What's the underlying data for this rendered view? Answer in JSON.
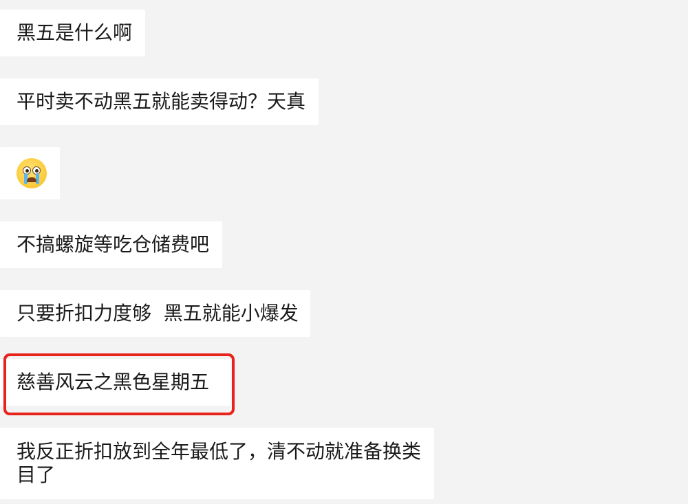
{
  "messages": [
    {
      "text": "黑五是什么啊"
    },
    {
      "text": "平时卖不动黑五就能卖得动？天真"
    },
    {
      "emoji": "crying-face-icon"
    },
    {
      "text": "不搞螺旋等吃仓储费吧"
    },
    {
      "text": "只要折扣力度够  黑五就能小爆发"
    },
    {
      "text": "慈善风云之黑色星期五",
      "highlighted": true
    },
    {
      "text": "我反正折扣放到全年最低了，清不动就准备换类目了"
    }
  ],
  "colors": {
    "background": "#f3f3f3",
    "bubble": "#ffffff",
    "text": "#1a1a1a",
    "highlight": "#e8231c"
  }
}
